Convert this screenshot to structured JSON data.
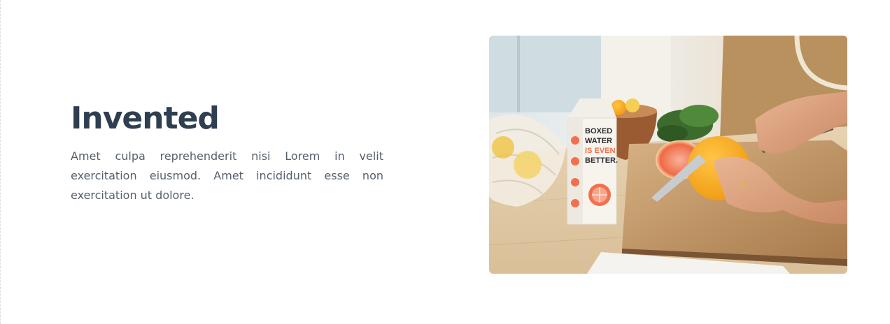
{
  "feature": {
    "title": "Invented",
    "description": "Amet culpa reprehenderit nisi Lorem in velit exercitation eiusmod. Amet incididunt esse non exercitation ut dolore."
  },
  "image": {
    "carton_lines": [
      "BOXED",
      "WATER",
      "IS EVEN",
      "BETTER."
    ],
    "accent": "#f1704d"
  }
}
